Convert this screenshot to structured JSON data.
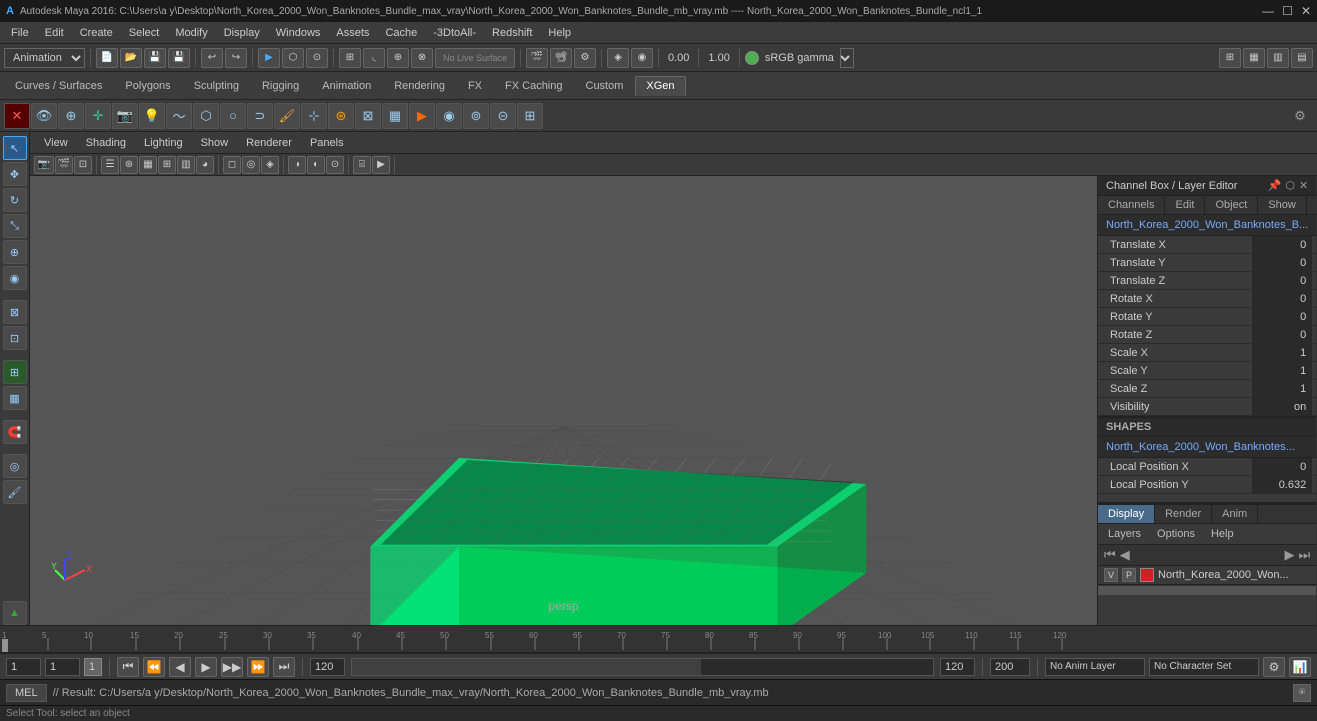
{
  "titleBar": {
    "icon": "🎯",
    "text": "Autodesk Maya 2016: C:\\Users\\a y\\Desktop\\North_Korea_2000_Won_Banknotes_Bundle_max_vray\\North_Korea_2000_Won_Banknotes_Bundle_mb_vray.mb  ----  North_Korea_2000_Won_Banknotes_Bundle_ncl1_1",
    "minimizeBtn": "—",
    "maximizeBtn": "☐",
    "closeBtn": "✕"
  },
  "menuBar": {
    "items": [
      "File",
      "Edit",
      "Create",
      "Select",
      "Modify",
      "Display",
      "Windows",
      "Assets",
      "Cache",
      "-3DtoAll-",
      "Redshift",
      "Help"
    ]
  },
  "toolbar": {
    "dropdown": "Animation",
    "liveBtn": "No Live Surface"
  },
  "shelfTabs": {
    "tabs": [
      "Curves / Surfaces",
      "Polygons",
      "Sculpting",
      "Rigging",
      "Animation",
      "Rendering",
      "FX",
      "FX Caching",
      "Custom",
      "XGen"
    ],
    "active": 9
  },
  "viewportMenu": {
    "items": [
      "View",
      "Shading",
      "Lighting",
      "Show",
      "Renderer",
      "Panels"
    ]
  },
  "viewport": {
    "label": "persp",
    "cameraLabel": "persp"
  },
  "channelBox": {
    "title": "Channel Box / Layer Editor",
    "tabs": [
      "Channels",
      "Edit",
      "Object",
      "Show"
    ],
    "objectName": "North_Korea_2000_Won_Banknotes_B...",
    "channels": [
      {
        "label": "Translate X",
        "value": "0"
      },
      {
        "label": "Translate Y",
        "value": "0"
      },
      {
        "label": "Translate Z",
        "value": "0"
      },
      {
        "label": "Rotate X",
        "value": "0"
      },
      {
        "label": "Rotate Y",
        "value": "0"
      },
      {
        "label": "Rotate Z",
        "value": "0"
      },
      {
        "label": "Scale X",
        "value": "1"
      },
      {
        "label": "Scale Y",
        "value": "1"
      },
      {
        "label": "Scale Z",
        "value": "1"
      },
      {
        "label": "Visibility",
        "value": "on"
      }
    ],
    "shapesHeader": "SHAPES",
    "shapeName": "North_Korea_2000_Won_Banknotes...",
    "shapeChannels": [
      {
        "label": "Local Position X",
        "value": "0"
      },
      {
        "label": "Local Position Y",
        "value": "0.632"
      }
    ]
  },
  "layerEditor": {
    "tabs": [
      "Display",
      "Render",
      "Anim"
    ],
    "activeTab": 0,
    "menus": [
      "Layers",
      "Options",
      "Help"
    ],
    "navIcons": [
      "⏮",
      "◀",
      "▶",
      "⏭"
    ],
    "layer": {
      "v": "V",
      "p": "P",
      "color": "#cc2222",
      "name": "North_Korea_2000_Won..."
    }
  },
  "timeline": {
    "ticks": [
      "1",
      "",
      "",
      "",
      "",
      "5",
      "",
      "",
      "",
      "",
      "10",
      "",
      "",
      "",
      "",
      "15",
      "",
      "",
      "",
      "",
      "20",
      "",
      "",
      "",
      "",
      "25",
      "",
      "",
      "",
      "",
      "30",
      "",
      "",
      "",
      "",
      "35",
      "",
      "",
      "",
      "",
      "40",
      "",
      "",
      "",
      "",
      "45",
      "",
      "",
      "",
      "",
      "50",
      "",
      "",
      "",
      "",
      "55",
      "",
      "",
      "",
      "",
      "60",
      "",
      "",
      "",
      "",
      "65",
      "",
      "",
      "",
      "",
      "70",
      "",
      "",
      "",
      "",
      "75",
      "",
      "",
      "",
      "",
      "80",
      "",
      "",
      "",
      "",
      "85",
      "",
      "",
      "",
      "",
      "90",
      "",
      "",
      "",
      "",
      "95",
      "",
      "",
      "",
      "",
      "100",
      "",
      "",
      "",
      "",
      "105",
      "",
      "",
      "",
      "",
      "110",
      "",
      "",
      "",
      "",
      "115",
      "",
      "",
      "",
      "",
      "120"
    ],
    "majorTicks": [
      1,
      5,
      10,
      15,
      20,
      25,
      30,
      35,
      40,
      45,
      50,
      55,
      60,
      65,
      70,
      75,
      80,
      85,
      90,
      95,
      100,
      105,
      110,
      115,
      120
    ]
  },
  "bottomBar": {
    "currentFrame": "1",
    "currentFrameVal": "1",
    "frameIndicator": "1",
    "frameStart": "1",
    "frameEnd": "120",
    "playbackStart": "1",
    "playbackEnd": "120",
    "rangeEnd": "200",
    "animLayer": "No Anim Layer",
    "charSet": "No Character Set",
    "playBtns": [
      "⏮",
      "◀",
      "◀",
      "▶",
      "▶",
      "⏭",
      "⏩",
      "⏪"
    ],
    "frameStepField": "1"
  },
  "statusBar": {
    "mode": "MEL",
    "statusText": "// Result: C:/Users/a y/Desktop/North_Korea_2000_Won_Banknotes_Bundle_max_vray/North_Korea_2000_Won_Banknotes_Bundle_mb_vray.mb",
    "tooltip": "Select Tool: select an object"
  },
  "sidebarTabs": {
    "channelBoxTab": "Channel Box / Layer Editor",
    "attributeEditorTab": "Channel Box / Layer Editor"
  },
  "icons": {
    "redX": "✕",
    "eye": "👁",
    "select": "⬡",
    "move": "✥",
    "rotate": "↻",
    "scale": "⤡",
    "softSelect": "◉",
    "gear": "⚙",
    "camera": "📷",
    "grid": "⊞",
    "snap": "🧲"
  }
}
